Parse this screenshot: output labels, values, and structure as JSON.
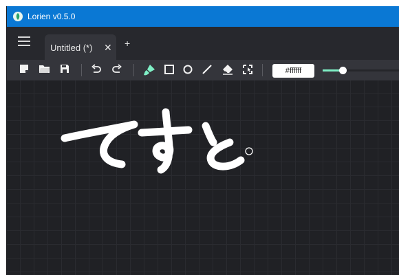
{
  "window": {
    "title": "Lorien v0.5.0"
  },
  "tabs": [
    {
      "label": "Untitled (*)"
    }
  ],
  "tab_close_glyph": "✕",
  "tab_add_glyph": "+",
  "toolbar": {
    "file_buttons": [
      "new-file-icon",
      "open-folder-icon",
      "save-icon"
    ],
    "history_buttons": [
      "undo-icon",
      "redo-icon"
    ],
    "tool_buttons": [
      "brush-icon",
      "rectangle-icon",
      "circle-icon",
      "line-icon",
      "eraser-icon",
      "selection-icon"
    ],
    "active_tool": "brush-icon",
    "brush_color": "#ffffff",
    "brush_size_level": 0.26
  },
  "colors": {
    "titlebar": "#0a78d4",
    "accent": "#7ff0c6",
    "canvas": "#202125"
  }
}
